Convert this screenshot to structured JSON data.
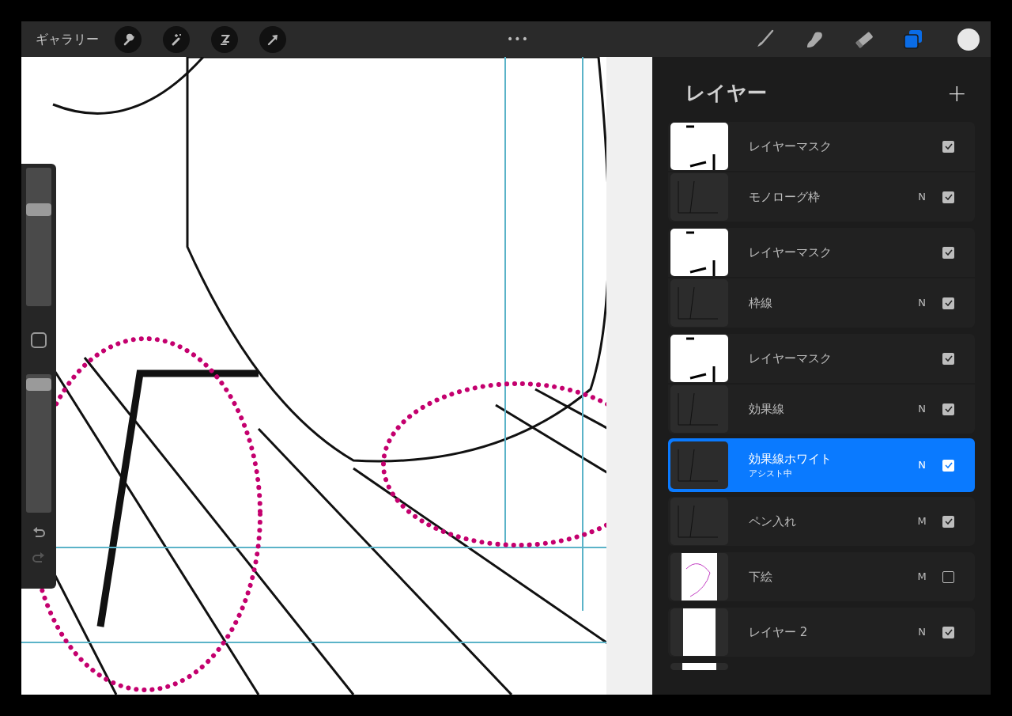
{
  "toolbar": {
    "gallery": "ギャラリー",
    "more": "•••",
    "tools": [
      {
        "kind": "brush",
        "selected": false
      },
      {
        "kind": "smudge",
        "selected": false
      },
      {
        "kind": "eraser",
        "selected": false
      },
      {
        "kind": "layers",
        "selected": true
      }
    ]
  },
  "sidebar": {
    "sliders": [
      {
        "level": 0.72
      },
      {
        "level": 0.97
      }
    ]
  },
  "layers_panel": {
    "title": "レイヤー",
    "add": "+",
    "layers": [
      {
        "kind": "mask",
        "name": "レイヤーマスク",
        "checked": true,
        "selected": false
      },
      {
        "kind": "layer",
        "name": "モノローグ枠",
        "mode": "N",
        "checked": true,
        "selected": false
      },
      {
        "kind": "mask",
        "name": "レイヤーマスク",
        "checked": true,
        "selected": false
      },
      {
        "kind": "layer",
        "name": "枠線",
        "mode": "N",
        "checked": true,
        "selected": false
      },
      {
        "kind": "mask",
        "name": "レイヤーマスク",
        "checked": true,
        "selected": false
      },
      {
        "kind": "layer",
        "name": "効果線",
        "mode": "N",
        "checked": true,
        "selected": false
      },
      {
        "kind": "layer",
        "name": "効果線ホワイト",
        "subtitle": "アシスト中",
        "mode": "N",
        "checked": true,
        "selected": true
      },
      {
        "kind": "layer",
        "name": "ペン入れ",
        "mode": "M",
        "checked": true,
        "selected": false
      },
      {
        "kind": "layer",
        "name": "下絵",
        "mode": "M",
        "checked": false,
        "selected": false
      },
      {
        "kind": "layer",
        "name": "レイヤー 2",
        "mode": "N",
        "checked": true,
        "selected": false
      },
      {
        "kind": "partial"
      }
    ]
  }
}
